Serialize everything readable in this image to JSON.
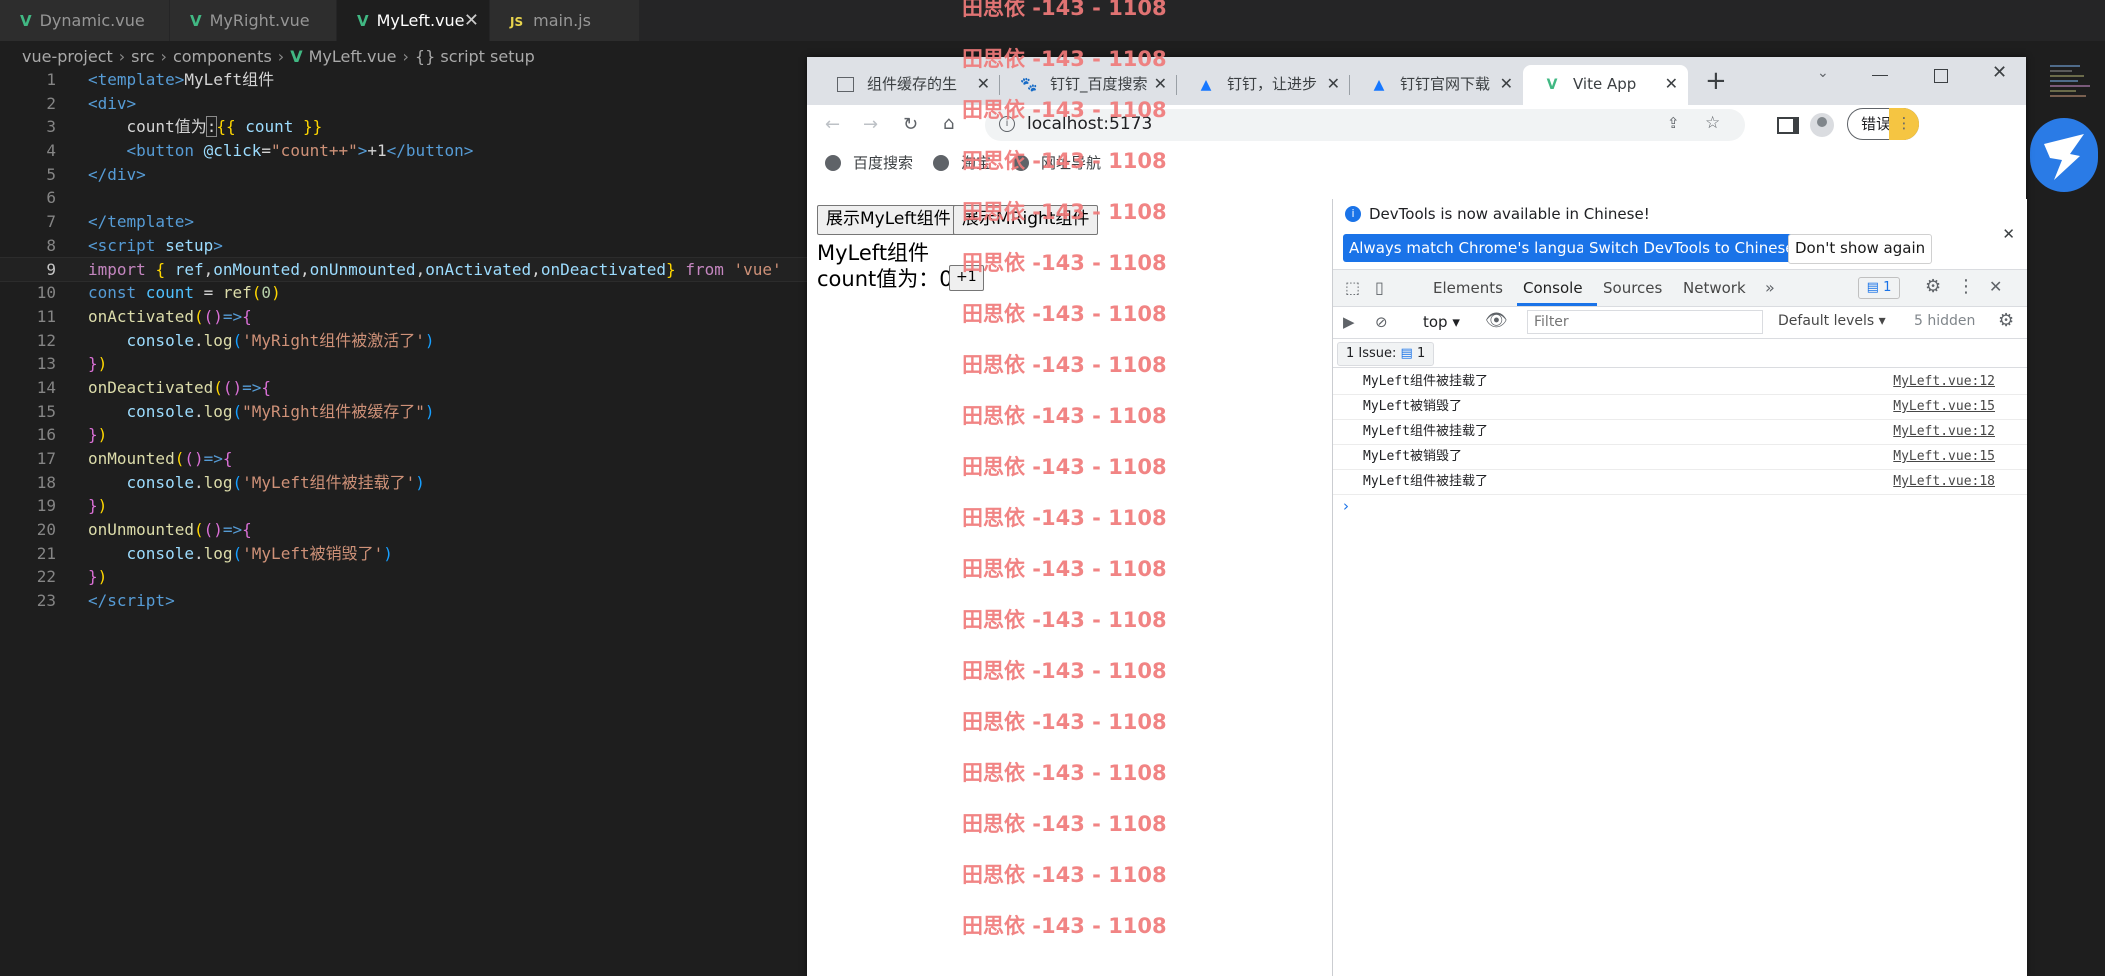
{
  "editor": {
    "tabs": [
      {
        "label": "Dynamic.vue",
        "type": "vue"
      },
      {
        "label": "MyRight.vue",
        "type": "vue"
      },
      {
        "label": "MyLeft.vue",
        "type": "vue",
        "active": true
      },
      {
        "label": "main.js",
        "type": "js"
      }
    ],
    "js_badge": "JS",
    "close_glyph": "✕",
    "breadcrumb": [
      "vue-project",
      "src",
      "components",
      "MyLeft.vue",
      "{} script setup"
    ],
    "current_line": 9
  },
  "browser": {
    "tabs": [
      "组件缓存的生",
      "钉钉_百度搜索",
      "钉钉，让进步",
      "钉钉官网下载",
      "Vite App"
    ],
    "address": "localhost:5173",
    "profile_button": "错误",
    "bookmarks": [
      "百度搜索",
      "淘宝",
      "网址导航"
    ],
    "page": {
      "button_left": "展示MyLeft组件",
      "button_right": "展示MRight组件",
      "component_title": "MyLeft组件",
      "count_label": "count值为：0",
      "plus_button": "+1"
    },
    "devtools": {
      "notice": "DevTools is now available in Chinese!",
      "btn_match": "Always match Chrome's language",
      "btn_switch": "Switch DevTools to Chinese",
      "btn_dont_show": "Don't show again",
      "tabs": [
        "Elements",
        "Console",
        "Sources",
        "Network"
      ],
      "issues_badge": "1",
      "context": "top",
      "filter_placeholder": "Filter",
      "levels": "Default levels",
      "hidden": "5 hidden",
      "issue_bar": "1 Issue:",
      "issue_count": "1",
      "messages": [
        {
          "text": "MyLeft组件被挂载了",
          "source": "MyLeft.vue:12"
        },
        {
          "text": "MyLeft被销毁了",
          "source": "MyLeft.vue:15"
        },
        {
          "text": "MyLeft组件被挂载了",
          "source": "MyLeft.vue:12"
        },
        {
          "text": "MyLeft被销毁了",
          "source": "MyLeft.vue:15"
        },
        {
          "text": "MyLeft组件被挂载了",
          "source": "MyLeft.vue:18"
        }
      ]
    }
  },
  "watermark": "田思依 -143 - 1108"
}
